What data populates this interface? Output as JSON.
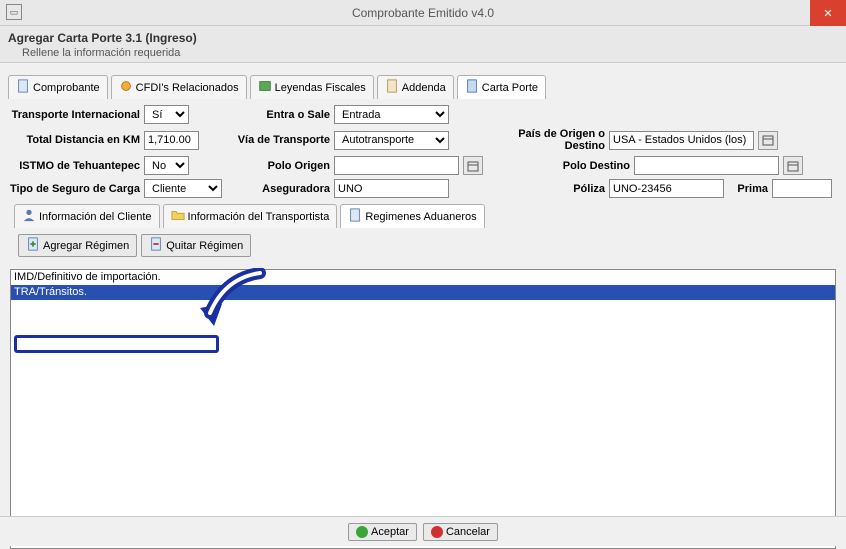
{
  "window": {
    "title": "Comprobante Emitido v4.0",
    "close": "✕"
  },
  "header": {
    "title": "Agregar Carta Porte 3.1 (Ingreso)",
    "subtitle": "Rellene la información requerida"
  },
  "outer_tabs": [
    {
      "label": "Comprobante",
      "icon": "document"
    },
    {
      "label": "CFDI's Relacionados",
      "icon": "link"
    },
    {
      "label": "Leyendas Fiscales",
      "icon": "book"
    },
    {
      "label": "Addenda",
      "icon": "page"
    },
    {
      "label": "Carta Porte",
      "icon": "blue"
    }
  ],
  "form": {
    "transporte_internacional_label": "Transporte Internacional",
    "transporte_internacional_value": "Sí",
    "entra_sale_label": "Entra o Sale",
    "entra_sale_value": "Entrada",
    "total_distancia_label": "Total Distancia en KM",
    "total_distancia_value": "1,710.00",
    "via_transporte_label": "Vía de Transporte",
    "via_transporte_value": "Autotransporte",
    "pais_origen_label": "País de Origen o Destino",
    "pais_origen_value": "USA - Estados Unidos (los)",
    "istmo_label": "ISTMO de Tehuantepec",
    "istmo_value": "No",
    "polo_origen_label": "Polo Origen",
    "polo_origen_value": "",
    "polo_destino_label": "Polo Destino",
    "polo_destino_value": "",
    "tipo_seguro_label": "Tipo de Seguro de Carga",
    "tipo_seguro_value": "Cliente",
    "aseguradora_label": "Aseguradora",
    "aseguradora_value": "UNO",
    "poliza_label": "Póliza",
    "poliza_value": "UNO-23456",
    "prima_label": "Prima",
    "prima_value": ""
  },
  "inner_tabs": [
    {
      "label": "Información del Cliente"
    },
    {
      "label": "Información del Transportista"
    },
    {
      "label": "Regimenes Aduaneros"
    }
  ],
  "buttons": {
    "agregar": "Agregar Régimen",
    "quitar": "Quitar Régimen"
  },
  "list": {
    "row0": "IMD/Definitivo de importación.",
    "row1": "TRA/Tránsitos."
  },
  "footer": {
    "ok": "Aceptar",
    "cancel": "Cancelar"
  }
}
